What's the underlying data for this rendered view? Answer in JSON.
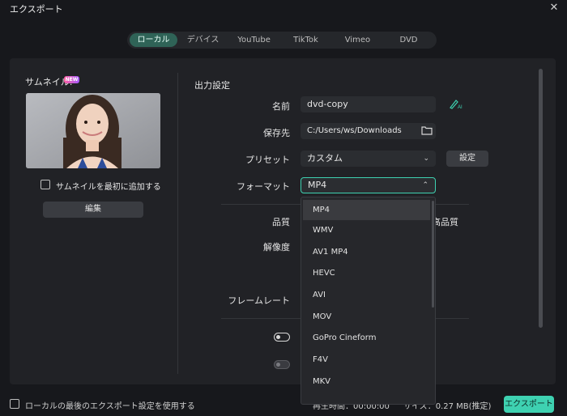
{
  "window": {
    "title": "エクスポート",
    "close_label": "✕"
  },
  "tabs": [
    {
      "label": "ローカル",
      "active": true
    },
    {
      "label": "デバイス",
      "active": false
    },
    {
      "label": "YouTube",
      "active": false
    },
    {
      "label": "TikTok",
      "active": false
    },
    {
      "label": "Vimeo",
      "active": false
    },
    {
      "label": "DVD",
      "active": false
    }
  ],
  "thumbnail": {
    "label": "サムネイル:",
    "badge": "NEW",
    "add_first_label": "サムネイルを最初に追加する",
    "add_first_checked": false,
    "edit_button": "編集"
  },
  "output": {
    "section_title": "出力設定",
    "name_label": "名前",
    "name_value": "dvd-copy",
    "save_label": "保存先",
    "save_value": "C:/Users/ws/Downloads",
    "preset_label": "プリセット",
    "preset_value": "カスタム",
    "preset_button": "設定",
    "format_label": "フォーマット",
    "format_value": "MP4",
    "quality_label": "品質",
    "quality_right_text": "高品質",
    "resolution_label": "解像度",
    "framerate_label": "フレームレート"
  },
  "format_dropdown": {
    "options": [
      "MP4",
      "WMV",
      "AV1 MP4",
      "HEVC",
      "AVI",
      "MOV",
      "GoPro Cineform",
      "F4V",
      "MKV"
    ],
    "selected": "MP4"
  },
  "footer": {
    "use_last_label": "ローカルの最後のエクスポート設定を使用する",
    "duration_text": "再生時間：00:00:00",
    "size_text": "サイズ：0.27 MB(推定)",
    "export_button": "エクスポート"
  },
  "colors": {
    "accent": "#3ed1b1",
    "active_tab": "#2f6357",
    "background": "#17181c",
    "panel": "#212226"
  }
}
